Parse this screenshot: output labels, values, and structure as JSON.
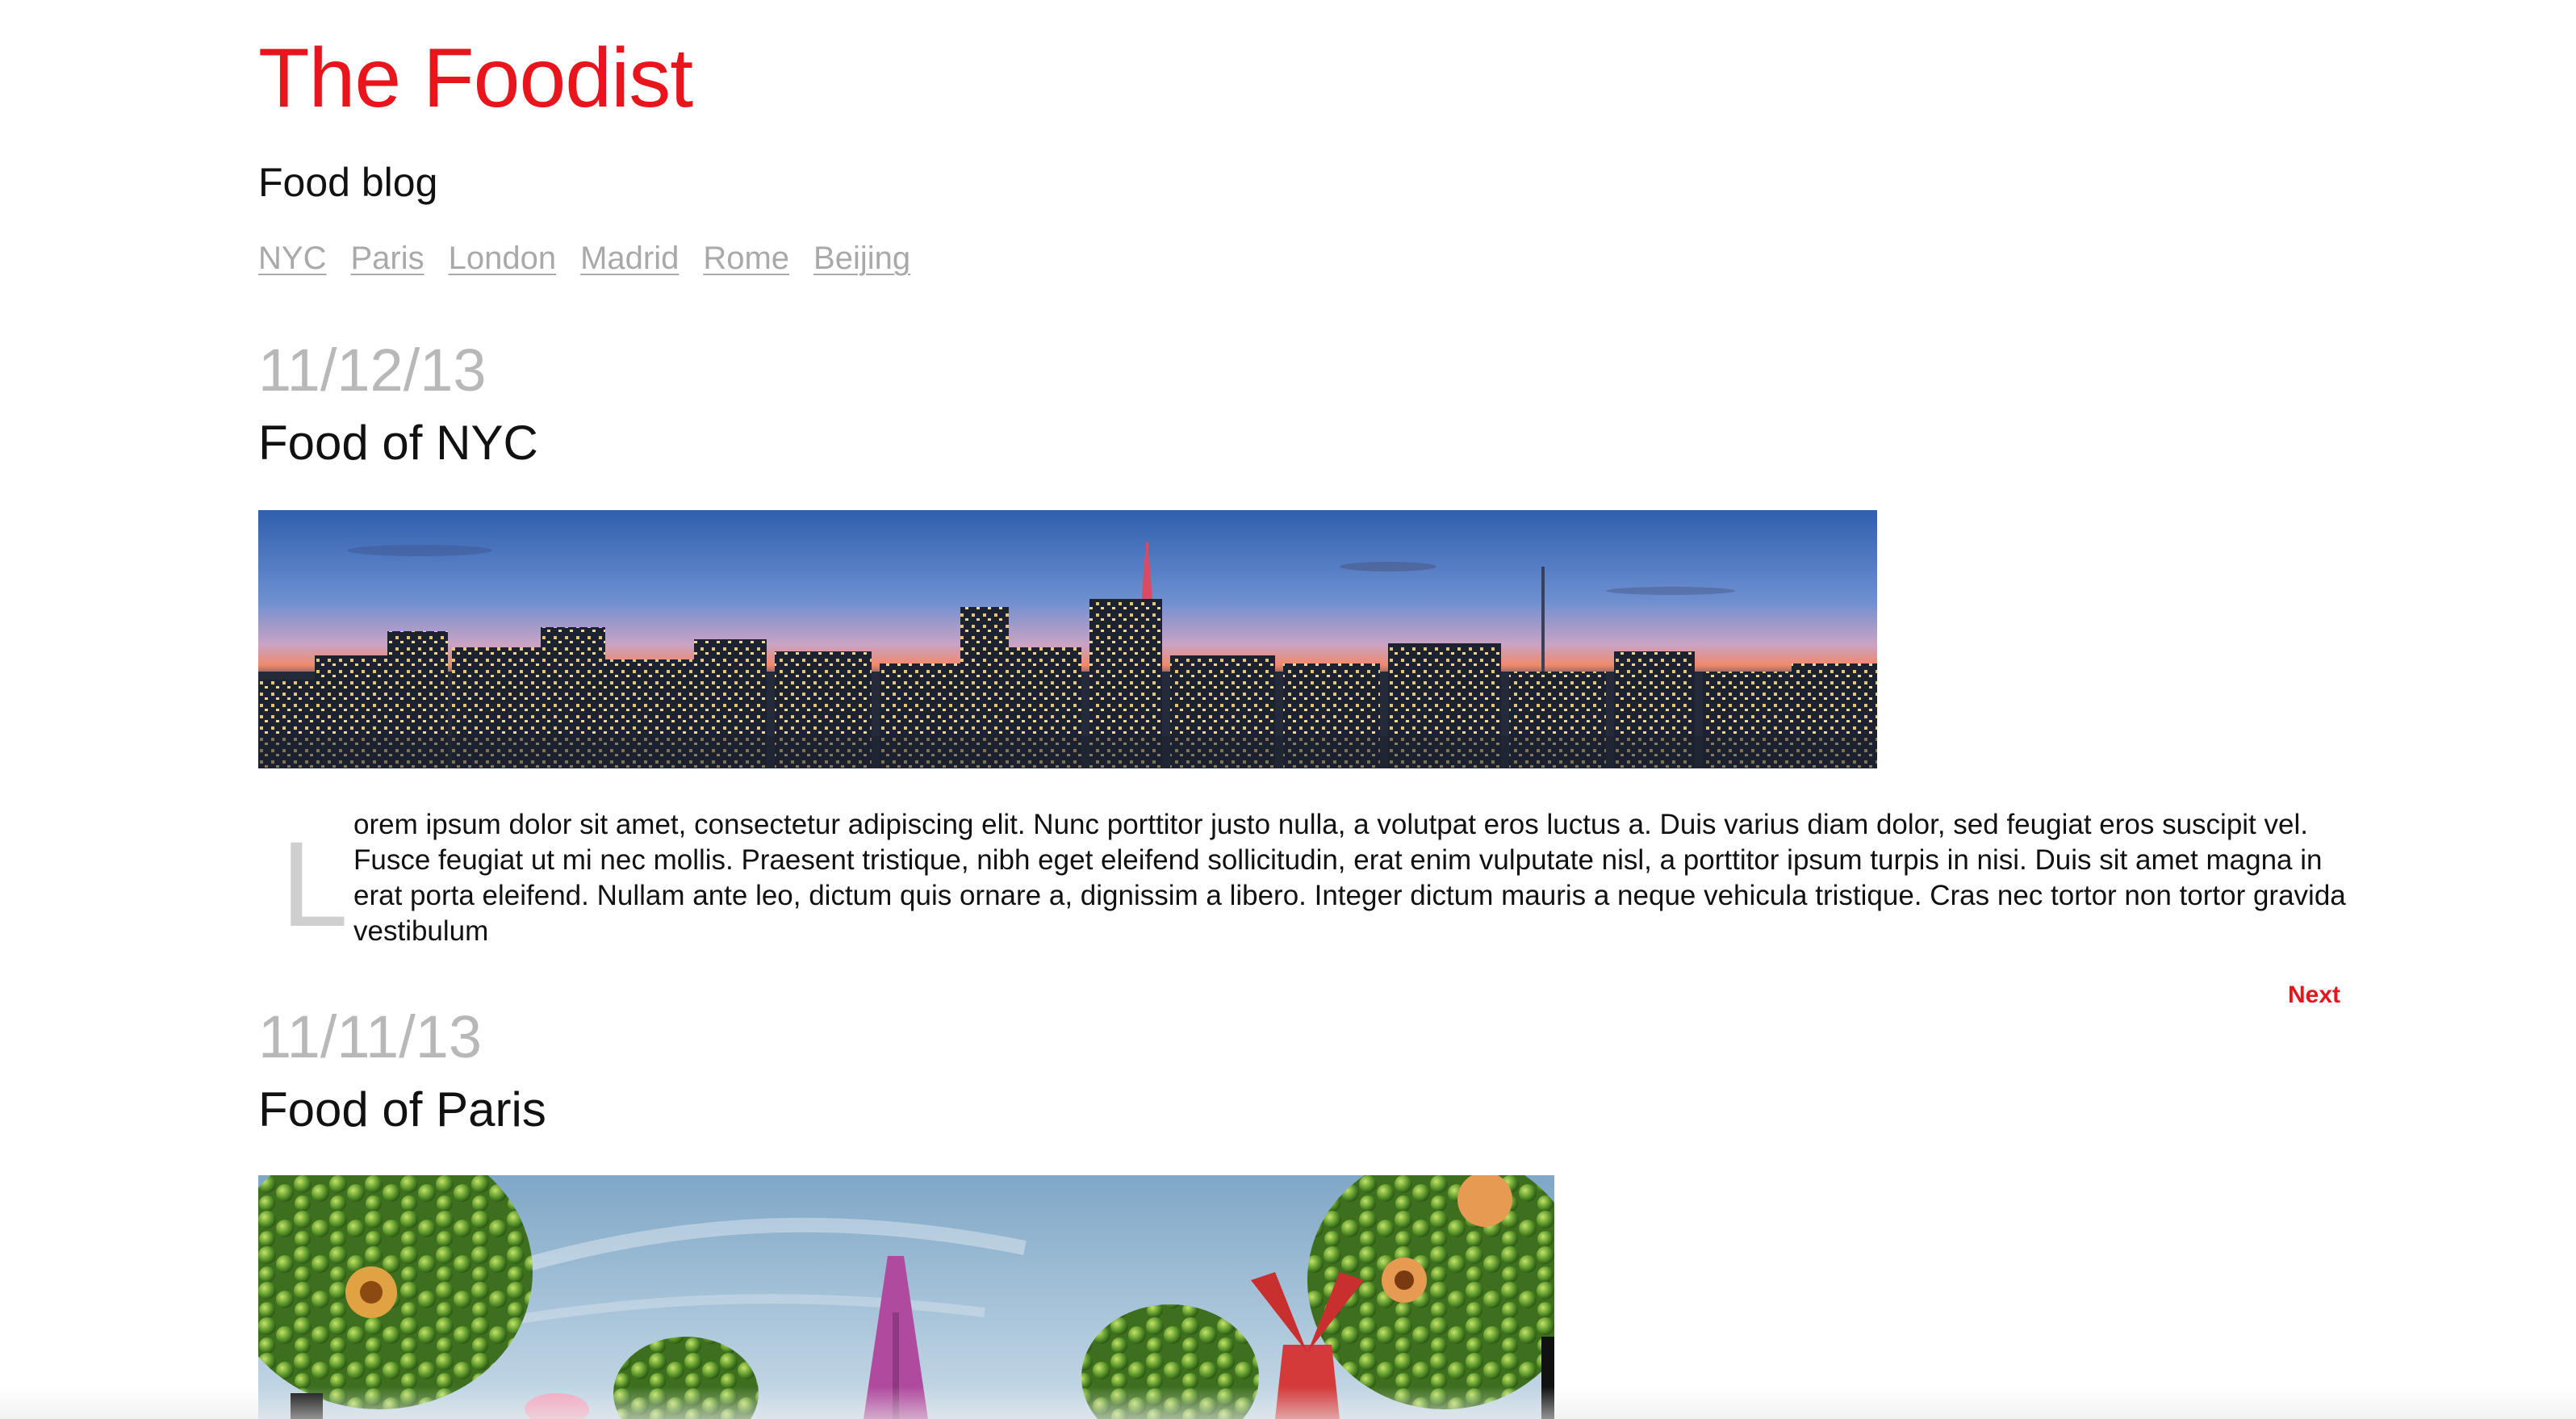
{
  "site": {
    "title": "The Foodist",
    "tagline": "Food blog",
    "title_color": "#e8161c"
  },
  "nav": {
    "items": [
      "NYC",
      "Paris",
      "London",
      "Madrid",
      "Rome",
      "Beijing"
    ],
    "link_color": "#a9a9a9"
  },
  "posts": [
    {
      "date": "11/12/13",
      "title": "Food of NYC",
      "image": "nyc-skyline-panorama",
      "dropcap": "L",
      "body": "orem ipsum dolor sit amet, consectetur adipiscing elit. Nunc porttitor justo nulla, a volutpat eros luctus a. Duis varius diam dolor, sed feugiat eros suscipit vel. Fusce feugiat ut mi nec mollis. Praesent tristique, nibh eget eleifend sollicitudin, erat enim vulputate nisl, a porttitor ipsum turpis in nisi. Duis sit amet magna in erat porta eleifend. Nullam ante leo, dictum quis ornare a, dignissim a libero. Integer dictum mauris a neque vehicula tristique. Cras nec tortor non tortor gravida vestibulum"
    },
    {
      "date": "11/11/13",
      "title": "Food of Paris",
      "image": "paris-food-landscape"
    }
  ],
  "pagination": {
    "next_label": "Next",
    "color": "#e8161c"
  }
}
